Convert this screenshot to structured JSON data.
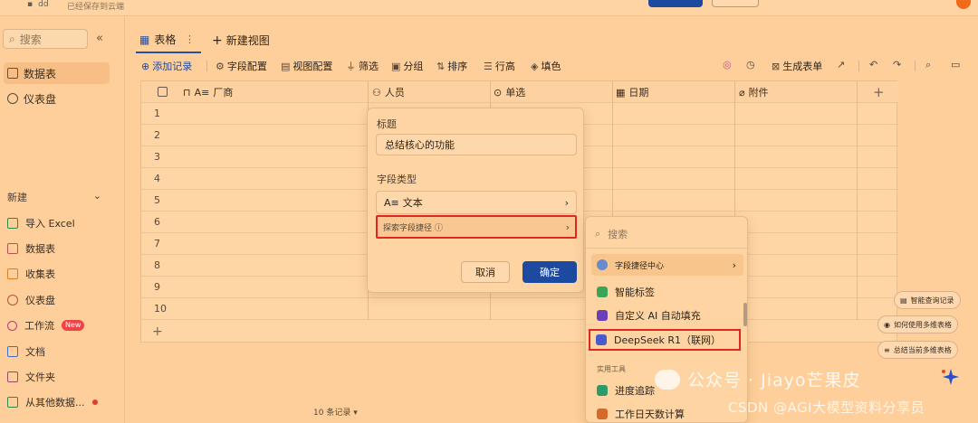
{
  "topbar": {
    "crumb_icon": "folder-icon",
    "crumb": "dd",
    "saved": "已经保存到云端"
  },
  "sidebar": {
    "search_placeholder": "搜索",
    "nav": [
      {
        "label": "数据表",
        "icon": "table-icon",
        "active": true
      },
      {
        "label": "仪表盘",
        "icon": "dashboard-icon",
        "active": false
      }
    ],
    "new_header": "新建",
    "new_items": [
      {
        "label": "导入 Excel",
        "icon": "excel-icon"
      },
      {
        "label": "数据表",
        "icon": "table-icon"
      },
      {
        "label": "收集表",
        "icon": "form-icon"
      },
      {
        "label": "仪表盘",
        "icon": "dashboard-icon"
      },
      {
        "label": "工作流",
        "icon": "workflow-icon",
        "badge": "New"
      },
      {
        "label": "文档",
        "icon": "doc-icon"
      },
      {
        "label": "文件夹",
        "icon": "folder-icon"
      },
      {
        "label": "从其他数据...",
        "icon": "import-icon",
        "dot": true
      }
    ]
  },
  "tabs": {
    "active": "表格",
    "new_view": "新建视图"
  },
  "toolbar": {
    "add_record": "添加记录",
    "field_config": "字段配置",
    "view_config": "视图配置",
    "filter": "筛选",
    "group": "分组",
    "sort": "排序",
    "row_height": "行高",
    "fill_color": "填色",
    "create_form": "生成表单"
  },
  "grid": {
    "columns": [
      {
        "label": "厂商",
        "icon": "text-field-icon"
      },
      {
        "label": "人员",
        "icon": "person-icon"
      },
      {
        "label": "单选",
        "icon": "single-select-icon"
      },
      {
        "label": "日期",
        "icon": "calendar-icon"
      },
      {
        "label": "附件",
        "icon": "attachment-icon"
      }
    ],
    "rows": [
      "1",
      "2",
      "3",
      "4",
      "5",
      "6",
      "7",
      "8",
      "9",
      "10"
    ],
    "record_count": "10 条记录"
  },
  "field_popover": {
    "title_label": "标题",
    "title_value": "总结核心的功能",
    "type_label": "字段类型",
    "type_value": "文本",
    "explore": "探索字段捷径",
    "cancel": "取消",
    "confirm": "确定"
  },
  "shortcut_menu": {
    "search_placeholder": "搜索",
    "hub": "字段捷径中心",
    "items": [
      {
        "label": "智能标签",
        "color": "#3aa655"
      },
      {
        "label": "自定义 AI 自动填充",
        "color": "#6a3fb8"
      },
      {
        "label": "DeepSeek R1（联网）",
        "color": "#4a5bd0"
      }
    ],
    "section": "实用工具",
    "tools": [
      {
        "label": "进度追踪",
        "color": "#2e9a6a"
      },
      {
        "label": "工作日天数计算",
        "color": "#d36a2a"
      }
    ]
  },
  "floating": {
    "smart_query": "智能查询记录",
    "how_to": "如何使用多维表格",
    "summarize": "总结当前多维表格"
  },
  "watermark": {
    "line1": "公众号 · Jiayo芒果皮",
    "line2": "CSDN @AGI大模型资料分享员"
  },
  "colors": {
    "accent": "#1d4aa0",
    "highlight_border": "#e0261e",
    "background": "#fecf9a"
  }
}
